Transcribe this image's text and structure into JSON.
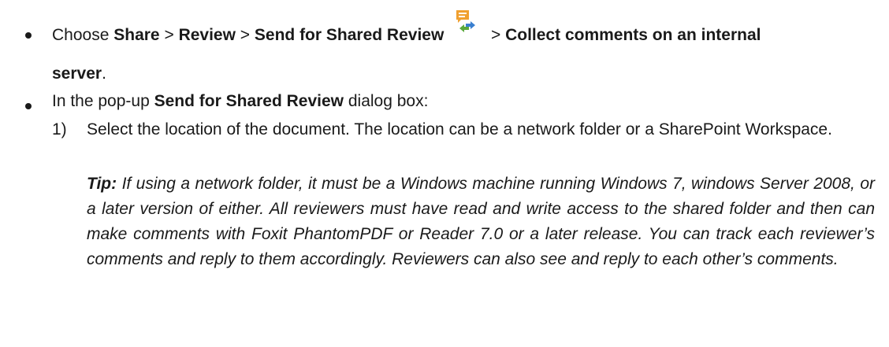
{
  "bullet1": {
    "choose": "Choose",
    "share": "Share",
    "sep1": ">",
    "review": "Review",
    "sep2": ">",
    "send_shared_review": "Send for Shared Review",
    "sep3": ">",
    "collect": "Collect comments on an internal",
    "server": "server",
    "period": "."
  },
  "bullet2": {
    "pre": "In the pop-up",
    "dialog_name": "Send for Shared Review",
    "post": "dialog box:"
  },
  "step1": {
    "number": "1)",
    "text": "Select the location of the document. The location can be a network folder or a SharePoint Workspace.",
    "tip_label": "Tip:",
    "tip_text": "If using a network folder, it must be a Windows machine running Windows 7, windows Server 2008, or a later version of either. All reviewers must have read and write access to the shared folder and then can make comments with Foxit PhantomPDF or Reader 7.0 or a later release. You can track each reviewer’s comments and reply to them accordingly. Reviewers can also see and reply to each other’s comments."
  },
  "icon": "send-for-shared-review-icon",
  "colors": {
    "icon_orange": "#f0a030",
    "icon_green": "#5aaa3c",
    "icon_blue": "#3a7fd0"
  }
}
